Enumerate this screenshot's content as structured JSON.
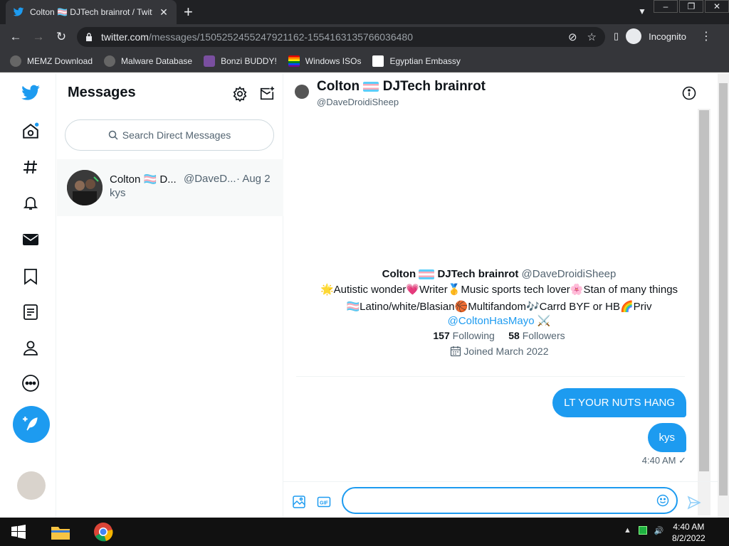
{
  "browser": {
    "tab_title": "Colton 🏳️‍⚧️ DJTech brainrot / Twitter",
    "url_domain": "twitter.com",
    "url_path": "/messages/1505252455247921162-1554163135766036480",
    "profile_label": "Incognito",
    "bookmarks": [
      {
        "label": "MEMZ Download",
        "icon": "globe-icon"
      },
      {
        "label": "Malware Database",
        "icon": "globe-icon"
      },
      {
        "label": "Bonzi BUDDY!",
        "icon": "bonzi-icon"
      },
      {
        "label": "Windows ISOs",
        "icon": "rainbow-flag-icon"
      },
      {
        "label": "Egyptian Embassy",
        "icon": "wix-icon"
      }
    ]
  },
  "messages_panel": {
    "title": "Messages",
    "search_placeholder": "Search Direct Messages",
    "conversations": [
      {
        "name": "Colton 🏳️‍⚧️ D...",
        "handle": "@DaveD...",
        "date": "· Aug 2",
        "preview": "kys"
      }
    ]
  },
  "chat": {
    "name": "Colton",
    "name_suffix": "DJTech brainrot",
    "handle": "@DaveDroidiSheep",
    "profile": {
      "name": "Colton",
      "name_suffix": "DJTech brainrot",
      "handle": "@DaveDroidiSheep",
      "bio_line1": "🌟Autistic wonder💗Writer🥇Music sports tech lover🌸Stan of many things",
      "bio_line2": "🏳️‍⚧️Latino/white/Blasian🏀Multifandom🎶Carrd BYF or HB🌈Priv",
      "mention": "@ColtonHasMayo ⚔️",
      "following_count": "157",
      "following_label": "Following",
      "followers_count": "58",
      "followers_label": "Followers",
      "joined": "Joined March 2022"
    },
    "messages": [
      {
        "text": "LT YOUR NUTS HANG"
      },
      {
        "text": "kys"
      }
    ],
    "last_time": "4:40 AM ✓",
    "composer_value": ""
  },
  "taskbar": {
    "time": "4:40 AM",
    "date": "8/2/2022"
  },
  "colors": {
    "twitter_blue": "#1d9bf0",
    "chrome_dark": "#202124",
    "chrome_toolbar": "#35363a"
  }
}
